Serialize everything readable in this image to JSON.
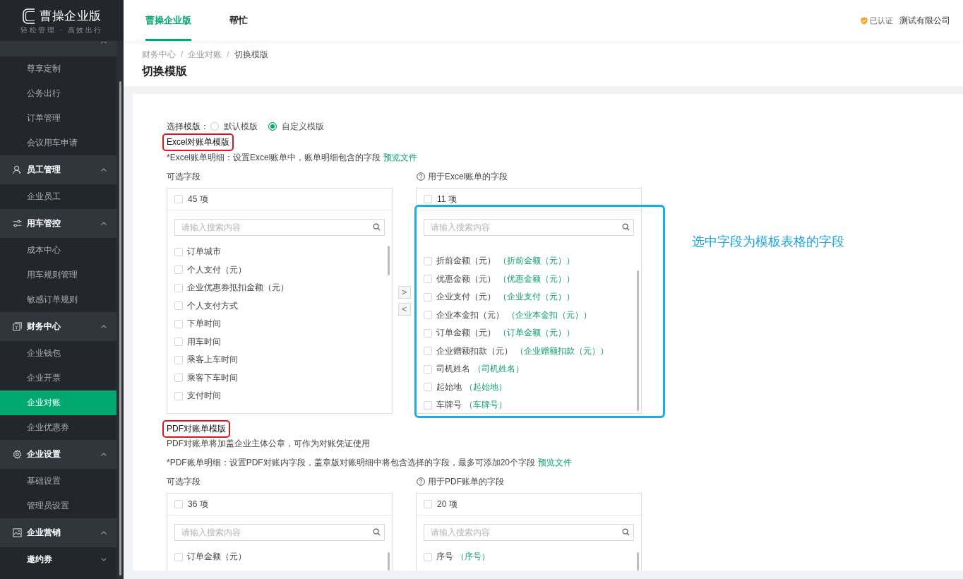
{
  "sidebar": {
    "logo": {
      "title": "曹操企业版",
      "slogan": "轻松管理 · 高效出行"
    },
    "groups": [
      {
        "expanded": true,
        "items": [
          {
            "label": "尊享定制",
            "kind": "link",
            "selected": false
          },
          {
            "label": "公务出行",
            "kind": "link",
            "selected": false
          },
          {
            "label": "订单管理",
            "kind": "link",
            "selected": false
          },
          {
            "label": "会议用车申请",
            "kind": "link",
            "selected": false
          }
        ]
      },
      {
        "label": "员工管理",
        "expanded": true,
        "items": [
          {
            "label": "企业员工",
            "kind": "link",
            "selected": false
          }
        ]
      },
      {
        "label": "用车管控",
        "expanded": true,
        "items": [
          {
            "label": "成本中心",
            "kind": "link",
            "selected": false
          },
          {
            "label": "用车规则管理",
            "kind": "link",
            "selected": false
          },
          {
            "label": "敏感订单规则",
            "kind": "link",
            "selected": false
          }
        ]
      },
      {
        "label": "财务中心",
        "expanded": true,
        "items": [
          {
            "label": "企业钱包",
            "kind": "link",
            "selected": false
          },
          {
            "label": "企业开票",
            "kind": "link",
            "selected": false
          },
          {
            "label": "企业对账",
            "kind": "link",
            "selected": true
          },
          {
            "label": "企业优惠券",
            "kind": "link",
            "selected": false
          }
        ]
      },
      {
        "label": "企业设置",
        "expanded": true,
        "items": [
          {
            "label": "基础设置",
            "kind": "link",
            "selected": false
          },
          {
            "label": "管理员设置",
            "kind": "link",
            "selected": false
          }
        ]
      },
      {
        "label": "企业营销",
        "expanded": true,
        "items": [
          {
            "label": "邀约券",
            "kind": "submenu",
            "expanded": false,
            "selected": false
          }
        ]
      }
    ]
  },
  "top_nav": {
    "tabs": [
      {
        "label": "曹操企业版",
        "selected": true
      },
      {
        "label": "帮忙",
        "selected": false
      }
    ],
    "verified_label": "已认证",
    "company": "测试有限公司"
  },
  "breadcrumb": {
    "separator": "/",
    "items": [
      "财务中心",
      "企业对账",
      "切换模版"
    ]
  },
  "page_title": "切换模版",
  "template_choice": {
    "label": "选择模版：",
    "options": [
      {
        "label": "默认模版",
        "selected": false
      },
      {
        "label": "自定义模版",
        "selected": true
      }
    ]
  },
  "sections": [
    {
      "title": "Excel对账单模版",
      "highlighted": true,
      "note": "*Excel账单明细：设置Excel账单中，账单明细包含的字段",
      "preview_link": "预览文件",
      "source": {
        "title": "可选字段",
        "count": "45 项",
        "all_checked": false,
        "placeholder": "请输入搜索内容",
        "items": [
          {
            "label": "订单城市",
            "checked": false
          },
          {
            "label": "个人支付（元）",
            "checked": false
          },
          {
            "label": "企业优惠券抵扣金额（元）",
            "checked": false
          },
          {
            "label": "个人支付方式",
            "checked": false
          },
          {
            "label": "下单时间",
            "checked": false
          },
          {
            "label": "用车时间",
            "checked": false
          },
          {
            "label": "乘客上车时间",
            "checked": false
          },
          {
            "label": "乘客下车时间",
            "checked": false
          },
          {
            "label": "支付时间",
            "checked": false
          }
        ]
      },
      "move_buttons": [
        ">",
        "<"
      ],
      "target": {
        "title": "用于Excel账单的字段",
        "count": "11 项",
        "all_checked": false,
        "placeholder": "请输入搜索内容",
        "items": [
          {
            "label": "折前金额（元）",
            "alias": "（折前金额（元））",
            "checked": false
          },
          {
            "label": "优惠金额（元）",
            "alias": "（优惠金额（元））",
            "checked": false
          },
          {
            "label": "企业支付（元）",
            "alias": "（企业支付（元））",
            "checked": false
          },
          {
            "label": "企业本金扣（元）",
            "alias": "（企业本金扣（元））",
            "checked": false
          },
          {
            "label": "订单金额（元）",
            "alias": "（订单金额（元））",
            "checked": false
          },
          {
            "label": "企业赠额扣款（元）",
            "alias": "（企业赠额扣款（元））",
            "checked": false
          },
          {
            "label": "司机姓名",
            "alias": "（司机姓名）",
            "checked": false
          },
          {
            "label": "起始地",
            "alias": "（起始地）",
            "checked": false
          },
          {
            "label": "车牌号",
            "alias": "（车牌号）",
            "checked": false
          }
        ]
      },
      "annotation": "选中字段为模板表格的字段"
    },
    {
      "title": "PDF对账单模版",
      "highlighted": true,
      "description": "PDF对账单将加盖企业主体公章，可作为对账凭证使用",
      "note": "*PDF账单明细：设置PDF对账内字段，盖章版对账明细中将包含选择的字段，最多可添加20个字段",
      "preview_link": "预览文件",
      "source": {
        "title": "可选字段",
        "count": "36 项",
        "all_checked": false,
        "placeholder": "请输入搜索内容",
        "items": [
          {
            "label": "订单金额（元）",
            "checked": false
          }
        ]
      },
      "target": {
        "title": "用于PDF账单的字段",
        "count": "20 项",
        "all_checked": false,
        "placeholder": "请输入搜索内容",
        "items": [
          {
            "label": "序号",
            "alias": "（序号）",
            "checked": false
          }
        ]
      }
    }
  ]
}
